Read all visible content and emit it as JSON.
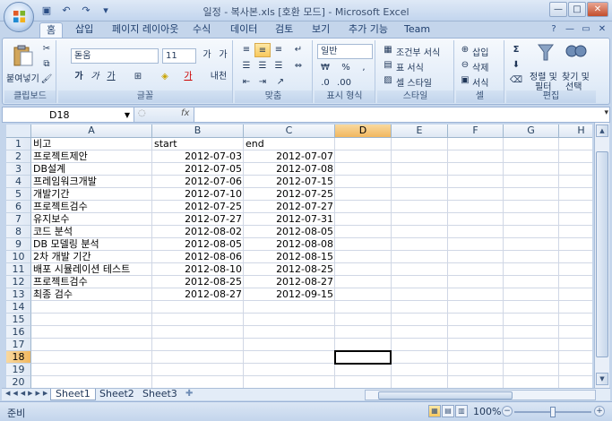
{
  "window": {
    "title": "일정 - 복사본.xls  [호환 모드] - Microsoft Excel"
  },
  "ribbon_tabs": [
    {
      "label": "홈",
      "active": true
    },
    {
      "label": "삽입"
    },
    {
      "label": "페이지 레이아웃"
    },
    {
      "label": "수식"
    },
    {
      "label": "데이터"
    },
    {
      "label": "검토"
    },
    {
      "label": "보기"
    },
    {
      "label": "추가 기능"
    },
    {
      "label": "Team"
    }
  ],
  "ribbon": {
    "clipboard": {
      "paste_label": "붙여넣기",
      "group_label": "클립보드"
    },
    "font": {
      "font_name": "돋움",
      "font_size": "11",
      "grow_label": "가",
      "shrink_label": "가",
      "bold": "가",
      "italic": "가",
      "underline": "가",
      "phonetic": "내천",
      "font_color_label": "가",
      "group_label": "글꼴"
    },
    "alignment": {
      "group_label": "맞춤"
    },
    "number": {
      "format": "일반",
      "percent": "%",
      "comma": ",",
      "group_label": "표시 형식"
    },
    "styles": {
      "conditional": "조건부 서식",
      "table": "표 서식",
      "cell": "셀 스타일",
      "group_label": "스타일"
    },
    "cells": {
      "insert": "삽입",
      "delete": "삭제",
      "format": "서식",
      "group_label": "셀"
    },
    "editing": {
      "sum": "Σ",
      "sort_filter": "정렬 및",
      "sort_filter2": "필터",
      "find_select": "찾기 및",
      "find_select2": "선택",
      "group_label": "편집"
    }
  },
  "formula_bar": {
    "name_box": "D18",
    "fx": "fx",
    "formula": ""
  },
  "columns": [
    "A",
    "B",
    "C",
    "D",
    "E",
    "F",
    "G",
    "H"
  ],
  "selected_column": "D",
  "selected_row": "18",
  "rows": [
    "1",
    "2",
    "3",
    "4",
    "5",
    "6",
    "7",
    "8",
    "9",
    "10",
    "11",
    "12",
    "13",
    "14",
    "15",
    "16",
    "17",
    "18",
    "19",
    "20"
  ],
  "cells": [
    {
      "a": "비고",
      "b": "start",
      "c": "end"
    },
    {
      "a": "프로젝트제안",
      "b": "2012-07-03",
      "c": "2012-07-07"
    },
    {
      "a": "DB설계",
      "b": "2012-07-05",
      "c": "2012-07-08"
    },
    {
      "a": "프레임워크개발",
      "b": "2012-07-06",
      "c": "2012-07-15"
    },
    {
      "a": "개발기간",
      "b": "2012-07-10",
      "c": "2012-07-25"
    },
    {
      "a": "프로젝트검수",
      "b": "2012-07-25",
      "c": "2012-07-27"
    },
    {
      "a": "유지보수",
      "b": "2012-07-27",
      "c": "2012-07-31"
    },
    {
      "a": "코드 분석",
      "b": "2012-08-02",
      "c": "2012-08-05"
    },
    {
      "a": "DB 모델링 분석",
      "b": "2012-08-05",
      "c": "2012-08-08"
    },
    {
      "a": "2차 개발 기간",
      "b": "2012-08-06",
      "c": "2012-08-15"
    },
    {
      "a": "배포 시뮬레이션 테스트",
      "b": "2012-08-10",
      "c": "2012-08-25"
    },
    {
      "a": "프로젝트검수",
      "b": "2012-08-25",
      "c": "2012-08-27"
    },
    {
      "a": "최종 검수",
      "b": "2012-08-27",
      "c": "2012-09-15"
    }
  ],
  "sheets": [
    {
      "label": "Sheet1",
      "active": true
    },
    {
      "label": "Sheet2"
    },
    {
      "label": "Sheet3"
    }
  ],
  "status": {
    "ready": "준비",
    "zoom": "100%",
    "zoom_minus": "−",
    "zoom_plus": "+"
  }
}
